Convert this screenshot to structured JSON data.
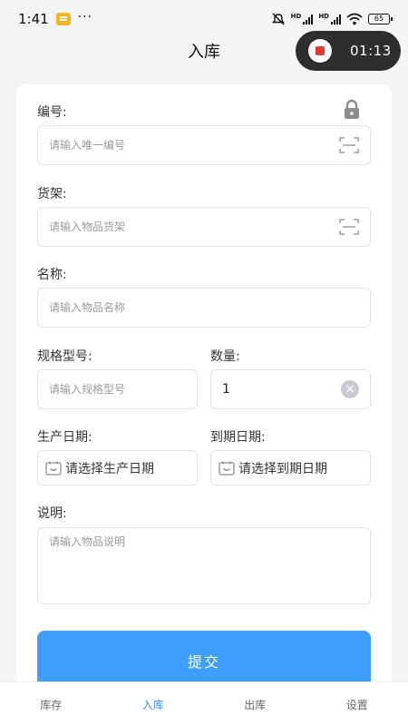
{
  "status_bar": {
    "time": "1:41",
    "dots": "···",
    "battery": "65",
    "hd1": "HD",
    "hd2": "HD"
  },
  "header": {
    "title": "入库"
  },
  "recorder": {
    "time": "01:13"
  },
  "form": {
    "code_label": "编号:",
    "code_placeholder": "请输入唯一编号",
    "shelf_label": "货架:",
    "shelf_placeholder": "请输入物品货架",
    "name_label": "名称:",
    "name_placeholder": "请输入物品名称",
    "spec_label": "规格型号:",
    "spec_placeholder": "请输入规格型号",
    "qty_label": "数量:",
    "qty_value": "1",
    "prod_date_label": "生产日期:",
    "prod_date_text": "请选择生产日期",
    "exp_date_label": "到期日期:",
    "exp_date_text": "请选择到期日期",
    "desc_label": "说明:",
    "desc_placeholder": "请输入物品说明",
    "submit_label": "提交"
  },
  "nav": {
    "items": [
      {
        "label": "库存",
        "active": false
      },
      {
        "label": "入库",
        "active": true
      },
      {
        "label": "出库",
        "active": false
      },
      {
        "label": "设置",
        "active": false
      }
    ]
  },
  "colors": {
    "accent": "#3e9ffa",
    "active_tab": "#3e8ef7",
    "record": "#e53935"
  }
}
